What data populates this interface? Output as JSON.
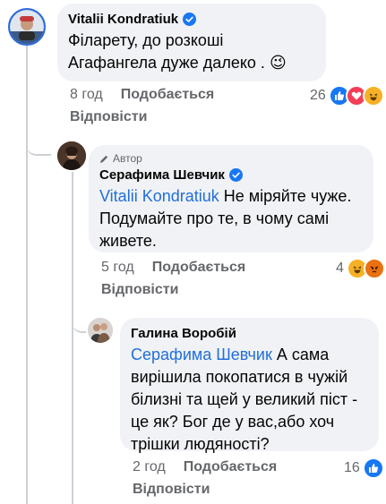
{
  "comments": [
    {
      "author": "Vitalii Kondratiuk",
      "text": "Філарету, до розкоші Агафангела дуже далеко .",
      "emoji": "😉",
      "time": "8 год",
      "like_label": "Подобається",
      "reply_label": "Відповісти",
      "reaction_count": "26",
      "reactions": [
        "like-icon",
        "love-icon",
        "haha-icon"
      ]
    },
    {
      "author_badge": "Автор",
      "author": "Серафима Шевчик",
      "mention": "Vitalii Kondratiuk",
      "text": "Не міряйте чуже. Подумайте про те, в чому самі живете.",
      "time": "5 год",
      "like_label": "Подобається",
      "reply_label": "Відповісти",
      "reaction_count": "4",
      "reactions": [
        "haha-icon",
        "angry-icon"
      ]
    },
    {
      "author": "Галина Воробій",
      "mention": "Серафима Шевчик",
      "text": "А сама вирішила покопатися в чужій білизні та щей у великий піст - це як? Бог де у вас,або хоч трішки людяності?",
      "time": "2 год",
      "like_label": "Подобається",
      "reply_label": "Відповісти",
      "reaction_count": "16",
      "reactions": [
        "like-icon"
      ]
    }
  ],
  "colors": {
    "bubble": "#f0f2f5",
    "mention": "#216fdb",
    "meta": "#65676b",
    "verified": "#1877f2",
    "thread": "#ccd0d5"
  }
}
